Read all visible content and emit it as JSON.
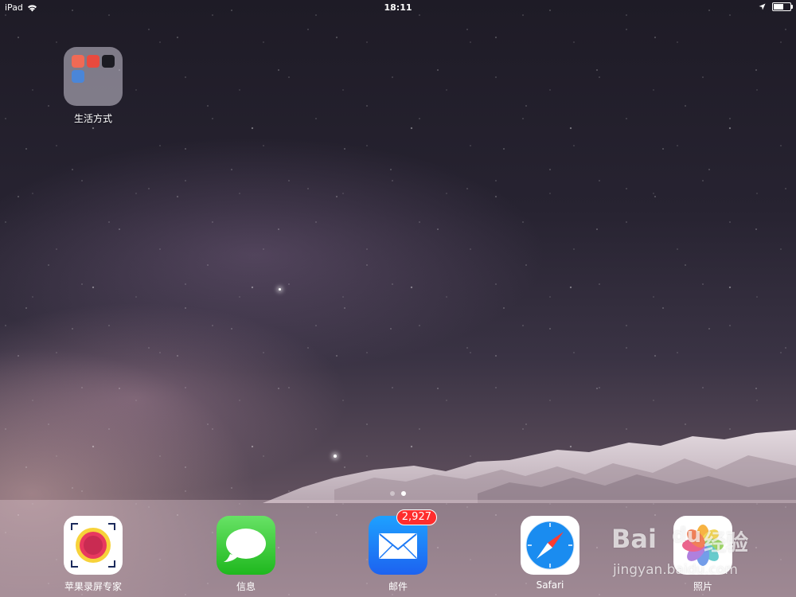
{
  "status_bar": {
    "device": "iPad",
    "time": "18:11"
  },
  "home_folders": [
    {
      "label": "生活方式"
    }
  ],
  "page_indicator": {
    "pages": 2,
    "current": 2
  },
  "dock": {
    "apps": [
      {
        "label": "苹果录屏专家",
        "icon": "screen-recorder-icon"
      },
      {
        "label": "信息",
        "icon": "messages-icon"
      },
      {
        "label": "邮件",
        "icon": "mail-icon",
        "badge": "2,927"
      },
      {
        "label": "Safari",
        "icon": "safari-compass-icon"
      },
      {
        "label": "照片",
        "icon": "photos-icon"
      }
    ]
  },
  "watermark": {
    "brand": "Bai",
    "brand_mark": "du",
    "product": "经验",
    "url": "jingyan.baidu.com"
  },
  "colors": {
    "badge": "#ff2d2d",
    "messages": "#2fc92e",
    "mail": "#1d7af5",
    "recorder_ring": "#f7d23a",
    "recorder_dot": "#e8385f"
  }
}
